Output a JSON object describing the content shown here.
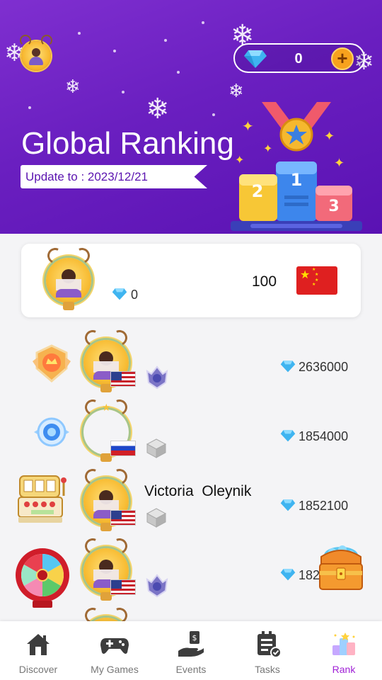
{
  "header": {
    "title": "Global Ranking",
    "update": "Update to : 2023/12/21",
    "balance": "0",
    "balance_add": "+"
  },
  "my_rank": {
    "diamonds": "0",
    "score": "100",
    "country": "China"
  },
  "leaderboard": [
    {
      "name": "",
      "score": "2636000",
      "country": "United States"
    },
    {
      "name": "",
      "score": "1854000",
      "country": "Russia"
    },
    {
      "name": "Victoria  Oleynik",
      "score": "1852100",
      "country": "United States"
    },
    {
      "name": "",
      "score": "182",
      "country": "United States"
    }
  ],
  "nav": [
    {
      "label": "Discover",
      "icon": "home-icon"
    },
    {
      "label": "My Games",
      "icon": "gamepad-icon"
    },
    {
      "label": "Events",
      "icon": "hand-money-icon"
    },
    {
      "label": "Tasks",
      "icon": "tasks-icon"
    },
    {
      "label": "Rank",
      "icon": "podium-icon",
      "active": true
    }
  ],
  "colors": {
    "header_bg": "#6a1fc0",
    "accent": "#a020d6",
    "gem": "#3fb4f0",
    "coin_plus": "#f7a21d"
  }
}
